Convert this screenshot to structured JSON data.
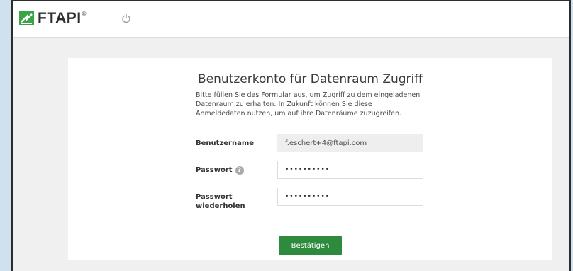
{
  "header": {
    "logo_text": "FTAPI",
    "logo_reg": "®",
    "logo_icon": "ftapi-logo-icon",
    "logout_icon": "power-icon"
  },
  "form": {
    "title": "Benutzerkonto für Datenraum Zugriff",
    "description": "Bitte füllen Sie das Formular aus, um Zugriff zu dem eingeladenen Datenraum zu erhalten. In Zukunft können Sie diese Anmeldedaten nutzen, um auf ihre Datenräume zuzugreifen.",
    "username": {
      "label": "Benutzername",
      "value": "f.eschert+4@ftapi.com"
    },
    "password": {
      "label": "Passwort",
      "help_icon": "question-circle-icon",
      "help_glyph": "?",
      "value": "••••••••••"
    },
    "password_repeat": {
      "label": "Passwort wiederholen",
      "value": "••••••••••"
    },
    "submit_label": "Bestätigen"
  },
  "colors": {
    "brand_green": "#2e8b3e",
    "page_background": "#f0f0f0"
  }
}
